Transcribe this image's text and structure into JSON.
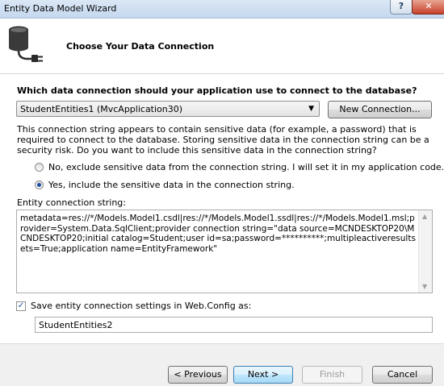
{
  "window": {
    "title": "Entity Data Model Wizard",
    "help_label": "?",
    "close_label": "✕"
  },
  "header": {
    "title": "Choose Your Data Connection",
    "icon": "database-plug-icon"
  },
  "connection": {
    "question": "Which data connection should your application use to connect to the database?",
    "selected": "StudentEntities1 (MvcApplication30)",
    "new_connection_label": "New Connection..."
  },
  "sensitive": {
    "warning": "This connection string appears to contain sensitive data (for example, a password) that is required to connect to the database. Storing sensitive data in the connection string can be a security risk. Do you want to include this sensitive data in the connection string?",
    "option_no": "No, exclude sensitive data from the connection string. I will set it in my application code.",
    "option_yes": "Yes, include the sensitive data in the connection string.",
    "selected_option": "yes"
  },
  "entity_connection": {
    "label": "Entity connection string:",
    "value": "metadata=res://*/Models.Model1.csdl|res://*/Models.Model1.ssdl|res://*/Models.Model1.msl;provider=System.Data.SqlClient;provider connection string=\"data source=MCNDESKTOP20\\MCNDESKTOP20;initial catalog=Student;user id=sa;password=**********;multipleactiveresultsets=True;application name=EntityFramework\""
  },
  "save_settings": {
    "checked": true,
    "label": "Save entity connection settings in Web.Config as:",
    "name_value": "StudentEntities2"
  },
  "footer": {
    "previous_label": "< Previous",
    "next_label": "Next >",
    "finish_label": "Finish",
    "cancel_label": "Cancel"
  }
}
